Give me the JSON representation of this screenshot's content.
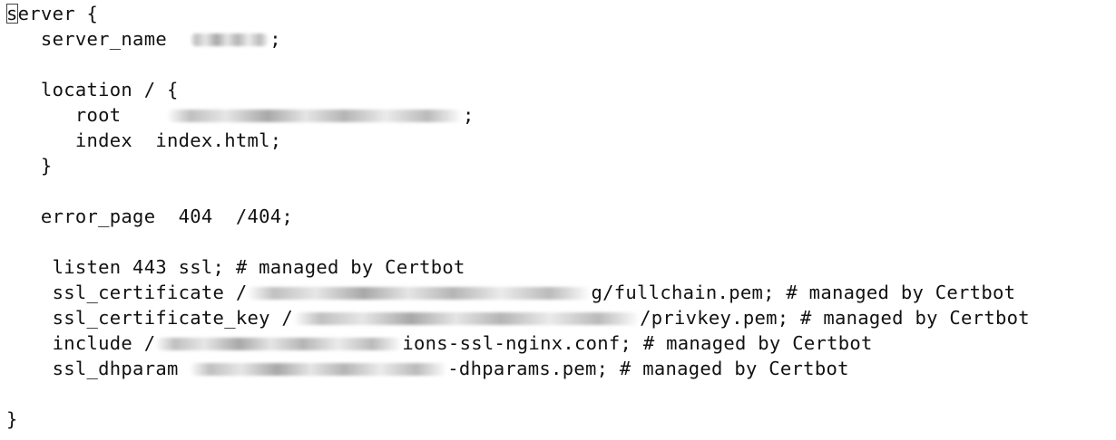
{
  "editor": {
    "cursor_char": "s",
    "lines": [
      "erver {",
      "   server_name  ",
      ";",
      "",
      "   location / {",
      "      root    ",
      ";",
      "      index  index.html;",
      "   }",
      "",
      "   error_page  404  /404;",
      "",
      "    listen 443 ssl; # managed by Certbot",
      "    ssl_certificate /",
      "g/fullchain.pem; # managed by Certbot",
      "    ssl_certificate_key /",
      "/privkey.pem; # managed by Certbot",
      "    include /",
      "ions-ssl-nginx.conf; # managed by Certbot",
      "    ssl_dhparam ",
      "-dhparams.pem; # managed by Certbot",
      "",
      "}"
    ]
  }
}
